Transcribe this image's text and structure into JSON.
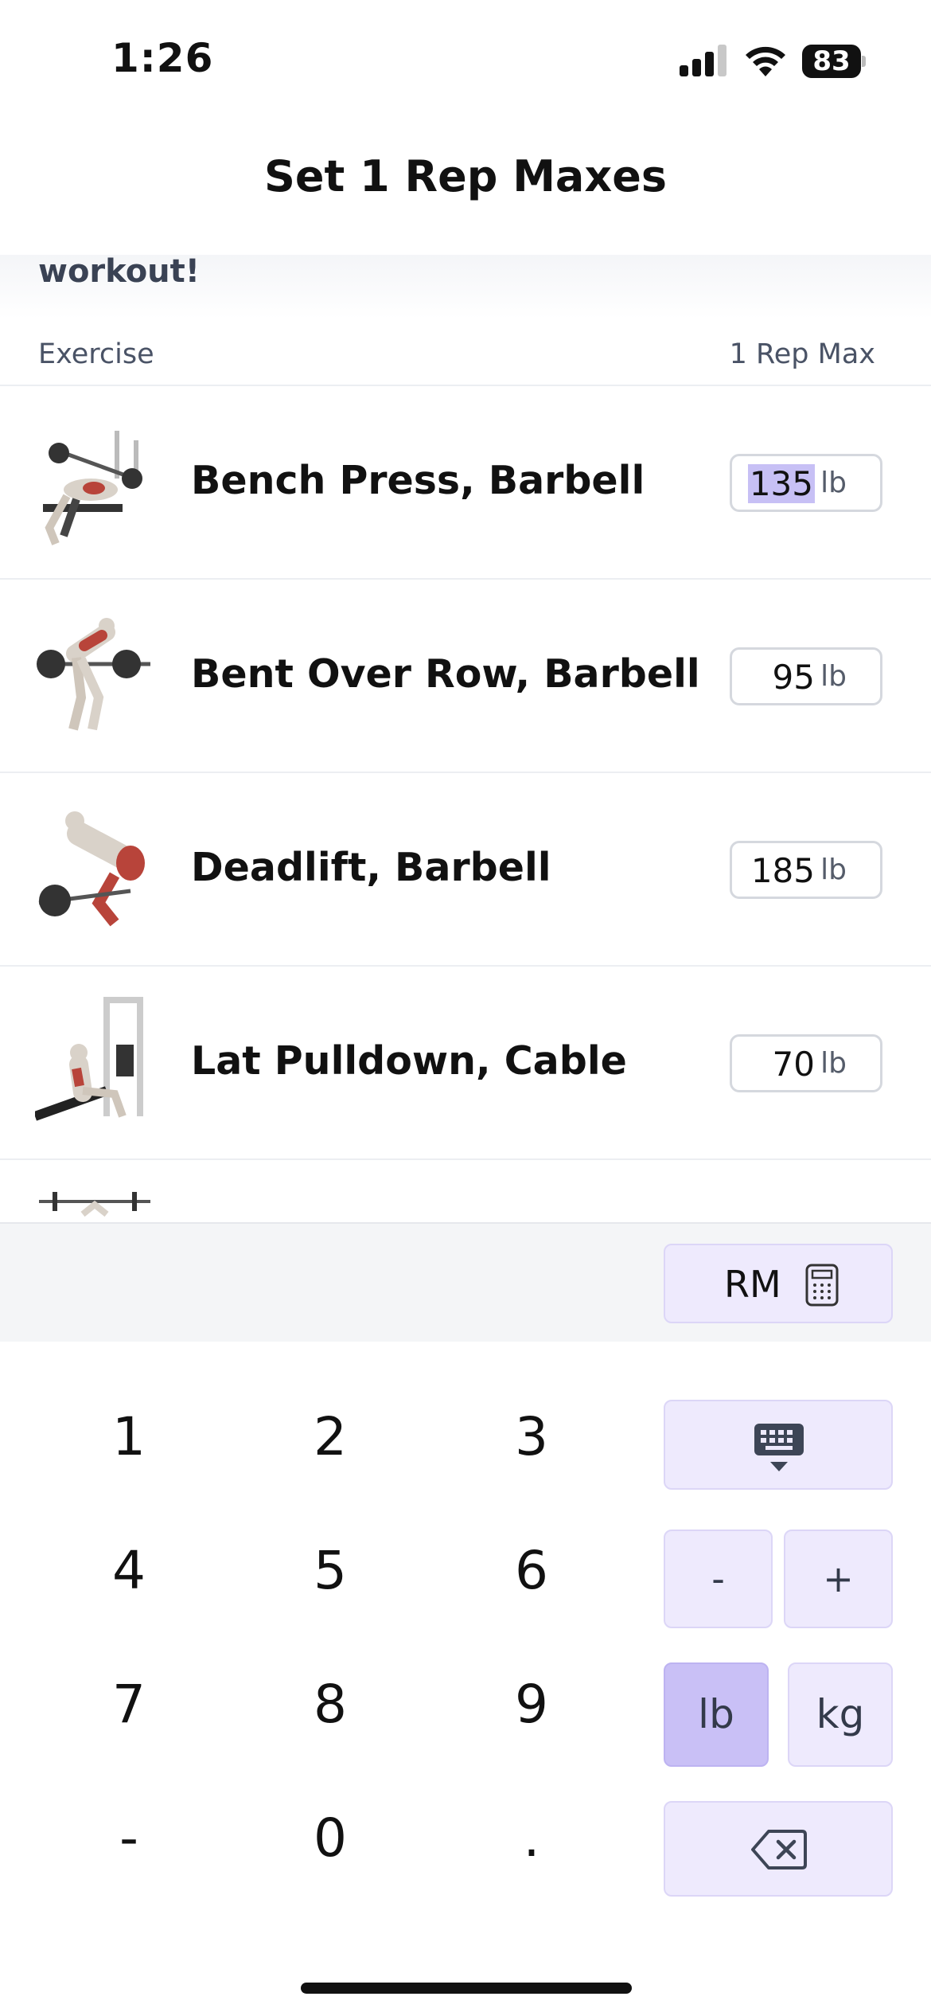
{
  "status_bar": {
    "time": "1:26",
    "battery": "83"
  },
  "header": {
    "title": "Set 1 Rep Maxes"
  },
  "banner": {
    "text": "workout!"
  },
  "columns": {
    "exercise": "Exercise",
    "one_rep_max": "1 Rep Max"
  },
  "exercises": [
    {
      "name": "Bench Press, Barbell",
      "value": "135",
      "unit": "lb",
      "thumb_icon": "bench-press-illustration"
    },
    {
      "name": "Bent Over Row, Barbell",
      "value": "95",
      "unit": "lb",
      "thumb_icon": "bent-over-row-illustration"
    },
    {
      "name": "Deadlift, Barbell",
      "value": "185",
      "unit": "lb",
      "thumb_icon": "deadlift-illustration"
    },
    {
      "name": "Lat Pulldown, Cable",
      "value": "70",
      "unit": "lb",
      "thumb_icon": "lat-pulldown-illustration"
    }
  ],
  "toolbar": {
    "rm_label": "RM",
    "rm_icon": "calculator-icon"
  },
  "keypad": {
    "keys": [
      "1",
      "2",
      "3",
      "4",
      "5",
      "6",
      "7",
      "8",
      "9",
      "-",
      "0",
      "."
    ],
    "minus": "-",
    "plus": "+",
    "unit_lb": "lb",
    "unit_kg": "kg",
    "selected_unit": "lb",
    "hide_keyboard_icon": "keyboard-dismiss-icon",
    "backspace_icon": "backspace-icon"
  },
  "colors": {
    "accent_light": "#eeeafd",
    "accent_selected": "#c9c0f6",
    "text_primary": "#111111",
    "text_secondary": "#4a5366"
  }
}
